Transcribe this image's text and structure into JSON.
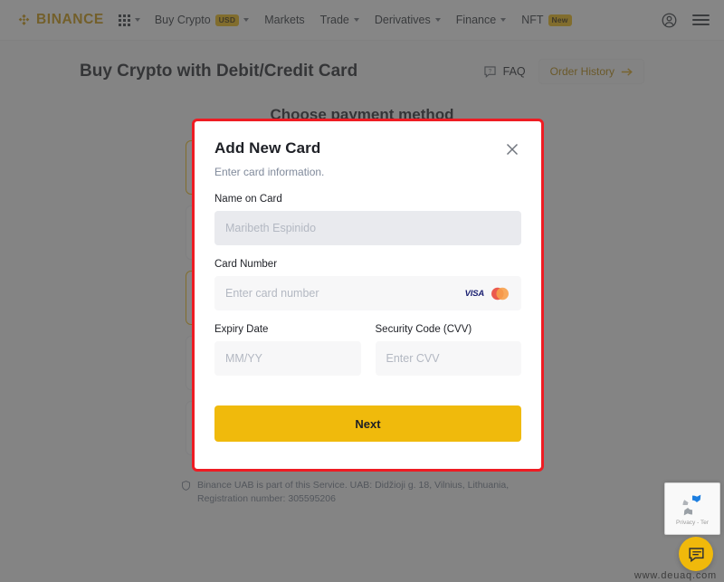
{
  "brand": {
    "name": "BINANCE",
    "accent": "#f0b90b",
    "logo_color": "#c99400"
  },
  "topnav": {
    "apps_icon": "grid-icon",
    "items": [
      {
        "label": "Buy Crypto",
        "badge": "USD",
        "caret": true
      },
      {
        "label": "Markets",
        "badge": "",
        "caret": false
      },
      {
        "label": "Trade",
        "badge": "",
        "caret": true
      },
      {
        "label": "Derivatives",
        "badge": "",
        "caret": true
      },
      {
        "label": "Finance",
        "badge": "",
        "caret": true
      },
      {
        "label": "NFT",
        "badge": "New",
        "caret": false
      }
    ],
    "profile_icon": "user-circle-icon",
    "menu_icon": "hamburger-icon"
  },
  "page": {
    "title": "Buy Crypto with Debit/Credit Card",
    "faq_label": "FAQ",
    "order_history_label": "Order History",
    "section_title": "Choose payment method",
    "footnote": "Binance UAB is part of this Service. UAB: Didžioji g. 18, Vilnius, Lithuania, Registration number: 305595206"
  },
  "modal": {
    "title": "Add New Card",
    "subtitle": "Enter card information.",
    "close_icon": "close-icon",
    "border_color": "#ee1c23",
    "fields": {
      "name_on_card": {
        "label": "Name on Card",
        "value": "",
        "placeholder": "Maribeth Espinido"
      },
      "card_number": {
        "label": "Card Number",
        "value": "",
        "placeholder": "Enter card number",
        "brands": [
          "VISA",
          "Mastercard"
        ]
      },
      "expiry_date": {
        "label": "Expiry Date",
        "value": "",
        "placeholder": "MM/YY"
      },
      "security_code": {
        "label": "Security Code (CVV)",
        "value": "",
        "placeholder": "Enter CVV"
      }
    },
    "submit_label": "Next"
  },
  "widgets": {
    "recaptcha_label": "Privacy - Ter",
    "chat_icon": "chat-bubble-icon",
    "watermark": "www.deuaq.com"
  }
}
